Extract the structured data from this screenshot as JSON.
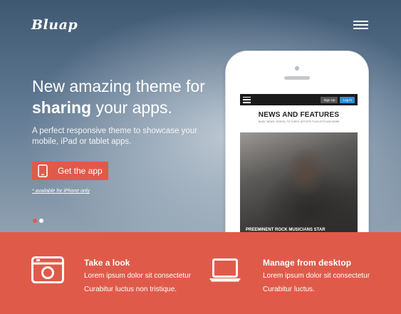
{
  "header": {
    "logo": "Bluap",
    "menu_icon": "hamburger-menu-icon"
  },
  "hero": {
    "headline_line1": "New amazing theme for",
    "headline_bold": "sharing",
    "headline_rest": " your apps.",
    "subtext": "A perfect responsive theme to showcase your mobile, iPad or tablet apps.",
    "cta_label": "Get the app",
    "cta_icon": "smartphone-icon",
    "footnote": "* available for iPhone only",
    "slides": 2,
    "active_slide": 1
  },
  "phone_screen": {
    "signup_label": "Sign Up",
    "login_label": "Log In",
    "title": "NEWS AND FEATURES",
    "subtitle": "MUSIC NEWS, VIDEOS, PICTURES, ARTISTS, PLAYLISTS AND MORE",
    "caption": "PREEMINENT ROCK MUSICIANS STAR"
  },
  "features": [
    {
      "icon": "camera-icon",
      "title": "Take a look",
      "line1": "Lorem ipsum dolor sit consectetur",
      "line2": "Curabitur luctus non tristique."
    },
    {
      "icon": "laptop-icon",
      "title": "Manage from desktop",
      "line1": "Lorem ipsum dolor sit consectetur",
      "line2": "Curabitur luctus."
    }
  ],
  "colors": {
    "accent": "#e05a4a",
    "text_light": "#ffffff"
  }
}
